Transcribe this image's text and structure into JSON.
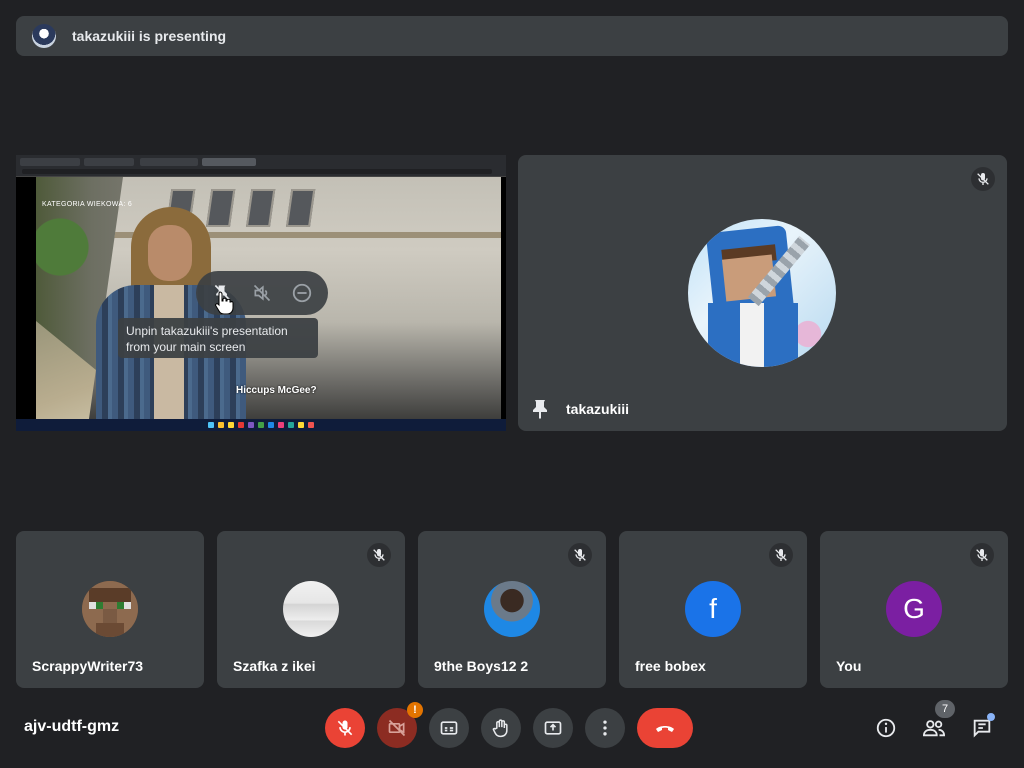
{
  "banner": {
    "text": "takazukiii is presenting"
  },
  "presentation": {
    "age_label": "KATEGORIA WIEKOWA: 6",
    "subtitle": "Hiccups McGee?",
    "tooltip_line1": "Unpin takazukiii's presentation",
    "tooltip_line2": "from your main screen",
    "hover_controls": [
      "unpin-icon",
      "mute-icon",
      "remove-icon"
    ]
  },
  "pinned_participant": {
    "name": "takazukiii",
    "muted": true
  },
  "participants": [
    {
      "name": "ScrappyWriter73",
      "muted": false,
      "avatar": "image"
    },
    {
      "name": "Szafka z ikei",
      "muted": true,
      "avatar": "image"
    },
    {
      "name": "9the Boys12 2",
      "muted": true,
      "avatar": "image"
    },
    {
      "name": "free bobex",
      "muted": true,
      "avatar": "letter",
      "letter": "f",
      "color": "#1a73e8"
    },
    {
      "name": "You",
      "muted": true,
      "avatar": "letter",
      "letter": "G",
      "color": "#7b1fa2"
    }
  ],
  "toolbar": {
    "meeting_code": "ajv-udtf-gmz",
    "camera_warning": "!",
    "people_count": "7"
  },
  "colors": {
    "background": "#202124",
    "tile": "#3c4043",
    "end_call": "#ea4335",
    "warning": "#e37400"
  }
}
